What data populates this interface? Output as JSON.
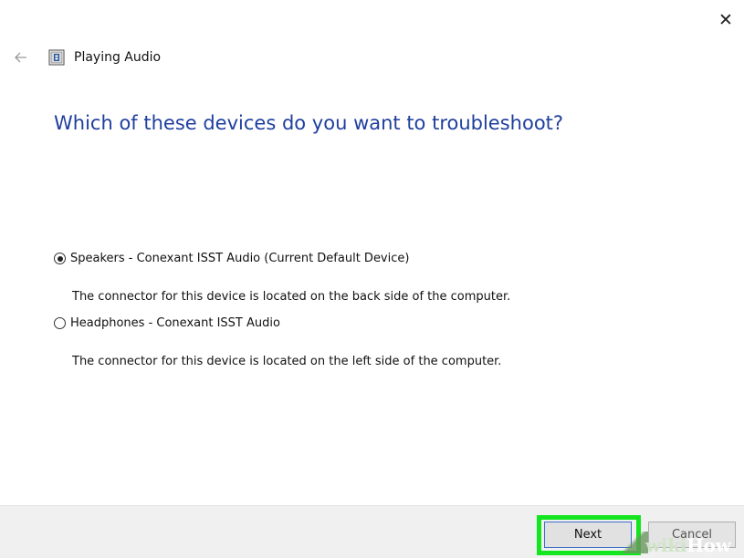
{
  "window": {
    "title": "Playing Audio",
    "close_glyph": "✕"
  },
  "icons": {
    "back": "back-arrow-icon",
    "app": "audio-troubleshooter-icon",
    "close": "close-icon"
  },
  "main": {
    "heading": "Which of these devices do you want to troubleshoot?",
    "options": [
      {
        "label": "Speakers - Conexant ISST Audio (Current Default Device)",
        "description": "The connector for this device is located on the back side of the computer.",
        "selected": true
      },
      {
        "label": "Headphones - Conexant ISST Audio",
        "description": "The connector for this device is located on the left side of the computer.",
        "selected": false
      }
    ]
  },
  "footer": {
    "next_label": "Next",
    "cancel_label": "Cancel"
  },
  "watermark": {
    "part1": "wiki",
    "part2": "How"
  },
  "colors": {
    "heading": "#1f3f9e",
    "highlight": "#13e51f",
    "footer_bg": "#f0f0f0",
    "button_focus_border": "#3d6fc9"
  }
}
